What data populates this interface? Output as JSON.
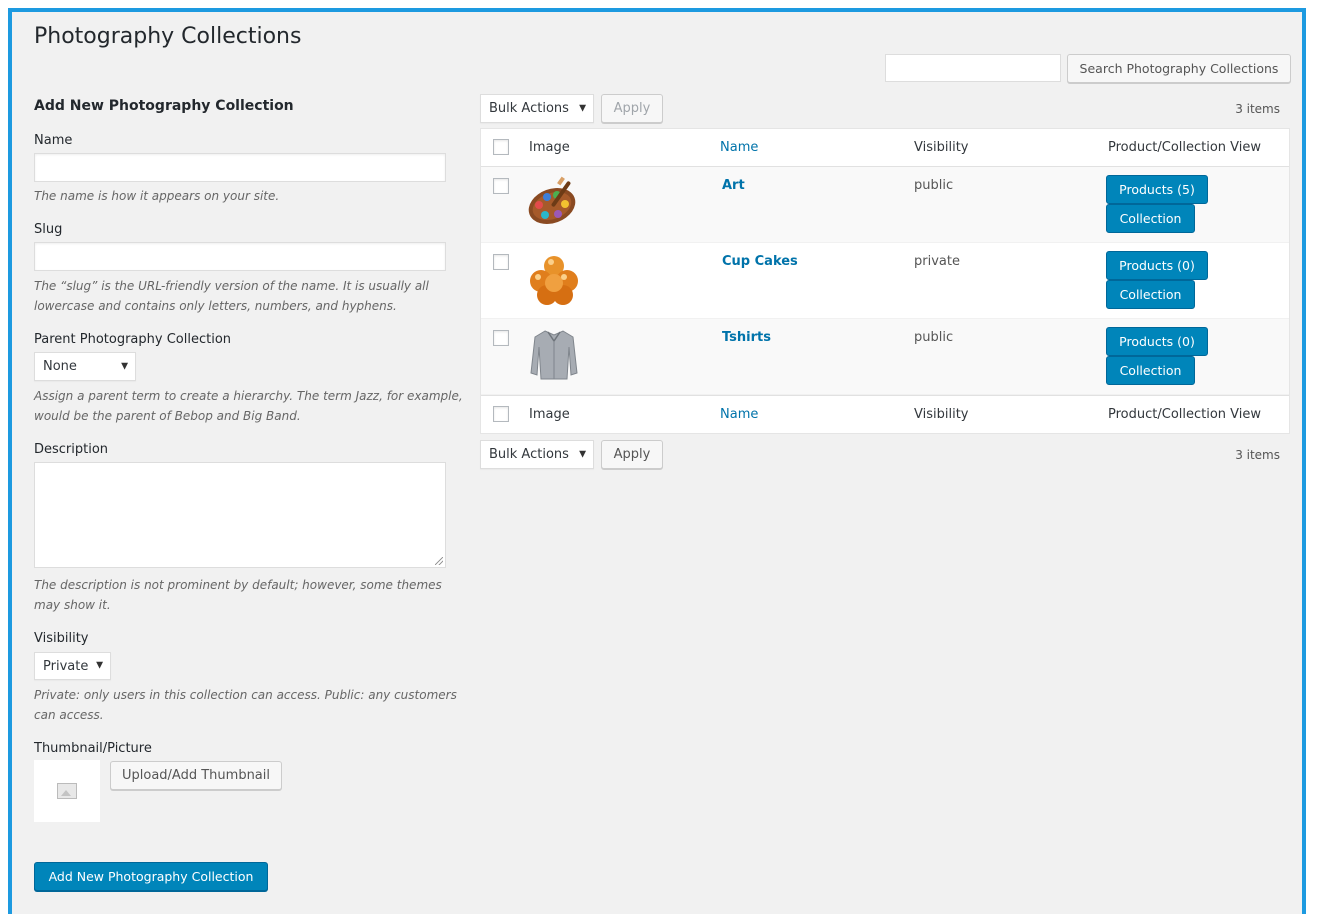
{
  "page": {
    "title": "Photography Collections"
  },
  "search": {
    "button_label": "Search Photography Collections",
    "value": ""
  },
  "form": {
    "title": "Add New Photography Collection",
    "name_label": "Name",
    "name_help": "The name is how it appears on your site.",
    "slug_label": "Slug",
    "slug_help_1": "The “slug” is the URL-friendly version of the name. It is usually all",
    "slug_help_2": "lowercase and contains only letters, numbers, and hyphens.",
    "parent_label": "Parent Photography Collection",
    "parent_value": "None",
    "parent_help_1": "Assign a parent term to create a hierarchy. The term Jazz, for example,",
    "parent_help_2": "would be the parent of Bebop and Big Band.",
    "description_label": "Description",
    "description_help_1": "The description is not prominent by default; however, some themes",
    "description_help_2": "may show it.",
    "visibility_label": "Visibility",
    "visibility_value": "Private",
    "visibility_help_1": "Private: only users in this collection can access. Public: any customers",
    "visibility_help_2": "can access.",
    "thumbnail_label": "Thumbnail/Picture",
    "upload_button": "Upload/Add Thumbnail",
    "submit_button": "Add New Photography Collection"
  },
  "table": {
    "bulk_actions": "Bulk Actions",
    "apply": "Apply",
    "count": "3 items",
    "columns": {
      "image": "Image",
      "name": "Name",
      "visibility": "Visibility",
      "view": "Product/Collection View"
    },
    "rows": [
      {
        "name": "Art",
        "visibility": "public",
        "products": "Products (5)",
        "collection": "Collection",
        "icon": "palette-icon"
      },
      {
        "name": "Cup Cakes",
        "visibility": "private",
        "products": "Products (0)",
        "collection": "Collection",
        "icon": "cupcakes-icon"
      },
      {
        "name": "Tshirts",
        "visibility": "public",
        "products": "Products (0)",
        "collection": "Collection",
        "icon": "shirt-icon"
      }
    ]
  },
  "colors": {
    "frame": "#1d9ae0",
    "primary": "#0085ba",
    "link": "#0073aa",
    "background": "#f1f1f1"
  }
}
